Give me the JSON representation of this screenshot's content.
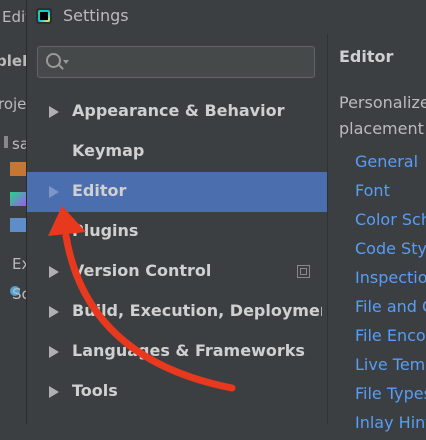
{
  "background": {
    "menu_label": "Edit",
    "project_label": "pleF",
    "rows": [
      {
        "text": "roje"
      },
      {
        "text": "sa"
      },
      {
        "text": "Ex"
      },
      {
        "text": "Sc"
      }
    ]
  },
  "dialog": {
    "title": "Settings",
    "search": {
      "placeholder": "",
      "value": ""
    },
    "tree": [
      {
        "label": "Appearance & Behavior",
        "expandable": true,
        "selected": false
      },
      {
        "label": "Keymap",
        "expandable": false,
        "selected": false
      },
      {
        "label": "Editor",
        "expandable": true,
        "selected": true
      },
      {
        "label": "Plugins",
        "expandable": false,
        "selected": false
      },
      {
        "label": "Version Control",
        "expandable": true,
        "selected": false,
        "icon": "project-scope-icon"
      },
      {
        "label": "Build, Execution, Deploymer",
        "expandable": true,
        "selected": false
      },
      {
        "label": "Languages & Frameworks",
        "expandable": true,
        "selected": false
      },
      {
        "label": "Tools",
        "expandable": true,
        "selected": false
      }
    ],
    "right_pane": {
      "title": "Editor",
      "description_lines": [
        "Personalize",
        "placement a"
      ],
      "links": [
        "General",
        "Font",
        "Color Sch",
        "Code Sty",
        "Inspection",
        "File and C",
        "File Enco",
        "Live Temp",
        "File Types",
        "Inlay Hint"
      ]
    }
  },
  "colors": {
    "selected": "#4b6eaf",
    "link": "#589df6",
    "annotation_arrow": "#e8381e"
  }
}
